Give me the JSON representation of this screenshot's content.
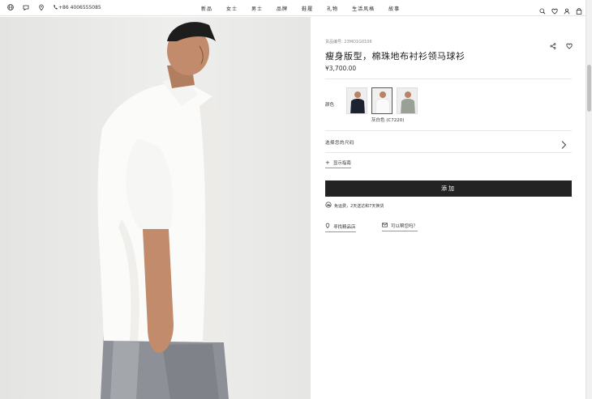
{
  "header": {
    "left_icons": [
      "globe-icon",
      "chat-icon",
      "location-pin-icon",
      "phone-icon"
    ],
    "phone": "+86 4006555085",
    "nav": [
      "新品",
      "女士",
      "男士",
      "品牌",
      "鞋履",
      "礼物",
      "生活风格",
      "故事"
    ],
    "right_icons": [
      "search-icon",
      "heart-icon",
      "user-icon",
      "shopping-bag-icon"
    ]
  },
  "product": {
    "sku": "货品编号: 23MO1G0106",
    "title": "瘦身版型，棉珠地布衬衫领马球衫",
    "price": "¥3,700.00",
    "color_label": "颜色",
    "swatches": [
      {
        "name": "navy",
        "selected": false
      },
      {
        "name": "white",
        "selected": true
      },
      {
        "name": "grey",
        "selected": false
      }
    ],
    "selected_color": "灰白色 (C7220)",
    "size_label": "选择您的尺码",
    "size_guide": "显示指南",
    "add_button": "添加",
    "delivery_note": "免运费，2天送达和7天换货",
    "link_store": "寻找精品店",
    "link_contact": "可以帮您吗？"
  },
  "colors": {
    "button_bg": "#232323",
    "divider": "#e6e6e6",
    "background": "#ffffff"
  }
}
